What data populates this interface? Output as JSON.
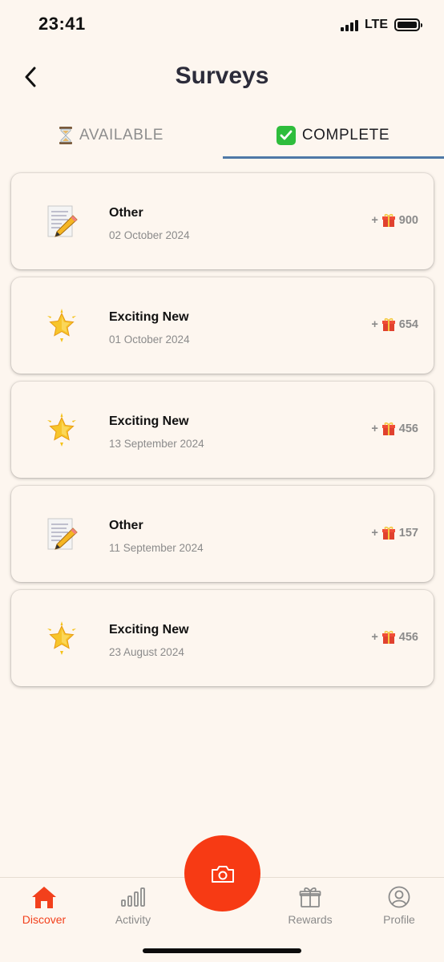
{
  "status_bar": {
    "time": "23:41",
    "network": "LTE"
  },
  "header": {
    "title": "Surveys"
  },
  "tabs": [
    {
      "label": "AVAILABLE",
      "icon": "hourglass-icon",
      "active": false
    },
    {
      "label": "COMPLETE",
      "icon": "check-mark-icon",
      "active": true
    }
  ],
  "colors": {
    "background": "#fdf6ef",
    "accent": "#f73a14",
    "tab_underline": "#4e79a7",
    "muted_text": "#8b8b8b"
  },
  "surveys": [
    {
      "icon": "memo-icon",
      "title": "Other",
      "date": "02 October 2024",
      "reward_prefix": "+",
      "reward": "900"
    },
    {
      "icon": "star-icon",
      "title": "Exciting New",
      "date": "01 October 2024",
      "reward_prefix": "+",
      "reward": "654"
    },
    {
      "icon": "star-icon",
      "title": "Exciting New",
      "date": "13 September 2024",
      "reward_prefix": "+",
      "reward": "456"
    },
    {
      "icon": "memo-icon",
      "title": "Other",
      "date": "11 September 2024",
      "reward_prefix": "+",
      "reward": "157"
    },
    {
      "icon": "star-icon",
      "title": "Exciting New",
      "date": "23 August 2024",
      "reward_prefix": "+",
      "reward": "456"
    }
  ],
  "bottom_nav": [
    {
      "label": "Discover",
      "icon": "home-icon",
      "active": true
    },
    {
      "label": "Activity",
      "icon": "bar-chart-icon",
      "active": false
    },
    {
      "label": "Rewards",
      "icon": "gift-icon",
      "active": false
    },
    {
      "label": "Profile",
      "icon": "profile-icon",
      "active": false
    }
  ],
  "fab": {
    "icon": "camera-icon"
  }
}
